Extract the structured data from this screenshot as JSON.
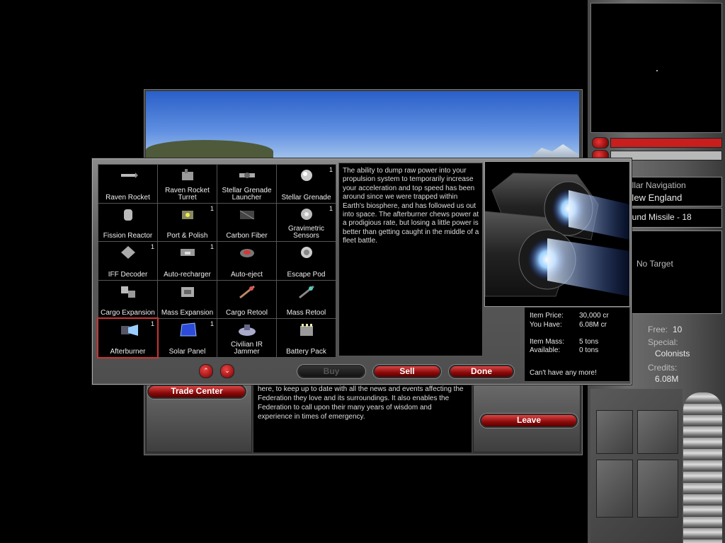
{
  "hud": {
    "nav_title": "ellar Navigation",
    "location": "New England",
    "weapon": "ound Missile - 18",
    "target": "No Target",
    "free_label": "Free:",
    "free_value": "10",
    "special_label": "Special:",
    "special_value": "Colonists",
    "credits_label": "Credits:",
    "credits_value": "6.08M",
    "bar1_color": "#c81e1e",
    "bar2_color": "#b8b8b8"
  },
  "station": {
    "trade_center_label": "Trade Center",
    "leave_label": "Leave",
    "news_text": "here, to keep up to date with all the news and events affecting the Federation they love and its surroundings.  It also enables the Federation to call upon their many years of wisdom and experience in times of emergency."
  },
  "shop": {
    "items": [
      {
        "name": "Raven Rocket",
        "qty": "",
        "icon": "rocket-icon"
      },
      {
        "name": "Raven Rocket Turret",
        "qty": "",
        "icon": "turret-icon"
      },
      {
        "name": "Stellar Grenade Launcher",
        "qty": "",
        "icon": "launcher-icon"
      },
      {
        "name": "Stellar Grenade",
        "qty": "1",
        "icon": "grenade-icon"
      },
      {
        "name": "Fission Reactor",
        "qty": "",
        "icon": "reactor-icon"
      },
      {
        "name": "Port & Polish",
        "qty": "1",
        "icon": "polish-icon"
      },
      {
        "name": "Carbon Fiber",
        "qty": "",
        "icon": "carbon-fiber-icon"
      },
      {
        "name": "Gravimetric Sensors",
        "qty": "1",
        "icon": "sensor-icon"
      },
      {
        "name": "IFF Decoder",
        "qty": "1",
        "icon": "decoder-icon"
      },
      {
        "name": "Auto-recharger",
        "qty": "1",
        "icon": "recharger-icon"
      },
      {
        "name": "Auto-eject",
        "qty": "",
        "icon": "eject-icon"
      },
      {
        "name": "Escape Pod",
        "qty": "",
        "icon": "escape-pod-icon"
      },
      {
        "name": "Cargo Expansion",
        "qty": "",
        "icon": "cargo-icon"
      },
      {
        "name": "Mass Expansion",
        "qty": "",
        "icon": "mass-icon"
      },
      {
        "name": "Cargo Retool",
        "qty": "",
        "icon": "cargo-retool-icon"
      },
      {
        "name": "Mass Retool",
        "qty": "",
        "icon": "mass-retool-icon"
      },
      {
        "name": "Afterburner",
        "qty": "1",
        "icon": "afterburner-icon"
      },
      {
        "name": "Solar Panel",
        "qty": "1",
        "icon": "solar-panel-icon"
      },
      {
        "name": "Civilian IR Jammer",
        "qty": "",
        "icon": "jammer-icon"
      },
      {
        "name": "Battery Pack",
        "qty": "",
        "icon": "battery-icon"
      }
    ],
    "selected_index": 16,
    "description": "The ability to dump raw power into your propulsion system to temporarily increase your acceleration and top speed has been around since we were trapped within Earth's biosphere, and has followed us out into space.  The afterburner chews power at a prodigious rate, but losing a little power is better than getting caught in the middle of a fleet battle.",
    "price_label": "Item Price:",
    "price_value": "30,000 cr",
    "have_label": "You Have:",
    "have_value": "6.08M cr",
    "mass_label": "Item Mass:",
    "mass_value": "5 tons",
    "avail_label": "Available:",
    "avail_value": "0 tons",
    "status": "Can't have any more!",
    "buy_label": "Buy",
    "sell_label": "Sell",
    "done_label": "Done",
    "up_arrow": "⌃",
    "down_arrow": "⌄"
  }
}
